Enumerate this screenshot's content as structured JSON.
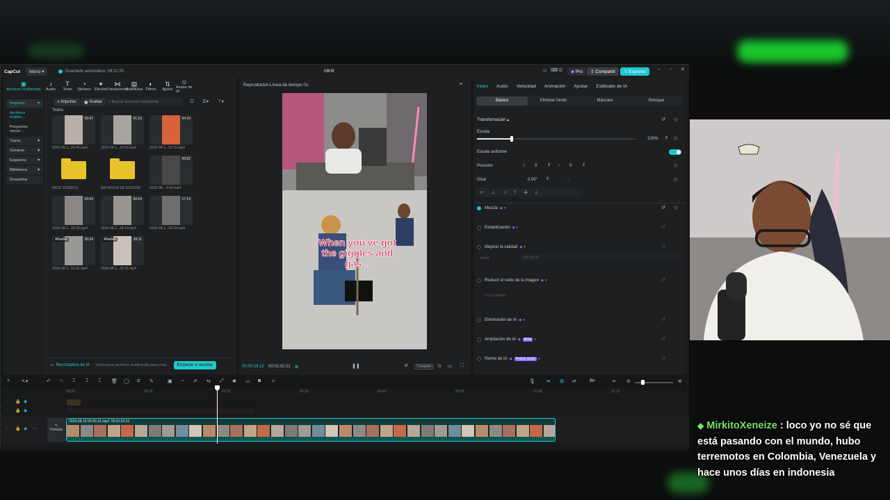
{
  "titlebar": {
    "app_name": "CapCut",
    "menu": "Menú",
    "autosave": "Guardado automático: 09:31:20",
    "project": "0809",
    "pro": "Pro",
    "share": "Compartir",
    "export": "Exportar"
  },
  "toolbar": {
    "items": [
      {
        "icon": "media-icon",
        "label": "Archivos multimedia"
      },
      {
        "icon": "audio-icon",
        "label": "Audio"
      },
      {
        "icon": "text-icon",
        "label": "Texto"
      },
      {
        "icon": "stickers-icon",
        "label": "Stickers"
      },
      {
        "icon": "effects-icon",
        "label": "Efectos"
      },
      {
        "icon": "transitions-icon",
        "label": "Transiciones"
      },
      {
        "icon": "subtitles-icon",
        "label": "Subtítulos"
      },
      {
        "icon": "filters-icon",
        "label": "Filtros"
      },
      {
        "icon": "adjust-icon",
        "label": "Ajuste"
      },
      {
        "icon": "avatar-icon",
        "label": "Avatar de IA"
      }
    ]
  },
  "sidebar": {
    "items": [
      "Importar",
      "Archivos multim...",
      "Proyectos secun...",
      "Tuyos",
      "Generar",
      "Espacios",
      "Biblioteca",
      "Dreamina"
    ]
  },
  "media": {
    "import": "Importar",
    "record": "Grabar",
    "search_placeholder": "Buscar archivos multimedia",
    "all": "Todos",
    "items": [
      {
        "name": "2026-08-1...03-45.mp4",
        "dur": "00:47"
      },
      {
        "name": "2026-08-1...10-09.mp4",
        "dur": "01:16"
      },
      {
        "name": "2026-08-1...22-15.mp4",
        "dur": "04:10"
      },
      {
        "name": "PACK SONIDOS",
        "dur": ""
      },
      {
        "name": "ARCHIVOS DE EDICION",
        "dur": ""
      },
      {
        "name": "2026-08-...4-43.mp4",
        "dur": "00:52"
      },
      {
        "name": "2026-08-1...49-33.mp4",
        "dur": "02:04"
      },
      {
        "name": "2026-08-1...28-13.mp4",
        "dur": "00:04"
      },
      {
        "name": "2026-08-1...26-23.mp4",
        "dur": "17:14"
      },
      {
        "name": "2026-08-1...51-01.mp4",
        "dur": "20:24",
        "badge": "Añadido"
      },
      {
        "name": "2026-08-1...36-31.mp4",
        "dur": "33:11",
        "badge": "Añadido"
      }
    ],
    "cutter_label": "Recortadora de IA",
    "cutter_hint": "Selecciona archivos multimedia para emp...",
    "cutter_button": "Empezar a recortar"
  },
  "player": {
    "title": "Reproductor-Línea de tiempo 01",
    "caption": "When you've got the giggles and gas...",
    "current": "00:00:19:12",
    "total": "00:01:02:21",
    "complete": "Completo"
  },
  "inspector": {
    "tabs": [
      "Vídeo",
      "Audio",
      "Velocidad",
      "Animación",
      "Ajustar",
      "Estilizado de IA"
    ],
    "subtabs": [
      "Básico",
      "Eliminar fondo",
      "Máscara",
      "Retoque"
    ],
    "transform": "Transformación",
    "scale": "Escala",
    "scale_value": "100%",
    "uniform": "Escala uniforme",
    "position": "Posición",
    "pos_x_label": "X",
    "pos_x": "0",
    "pos_y_label": "Y",
    "pos_y": "0",
    "rotate": "Girar",
    "rotate_value": "0.00°",
    "rotate_dash": "-",
    "sections": [
      {
        "label": "Mezcla",
        "on": true
      },
      {
        "label": "Estabilización",
        "on": false
      },
      {
        "label": "Mejorar la calidad",
        "on": false
      },
      {
        "label": "Reducir el ruido de la imagen",
        "on": false
      },
      {
        "label": "Eliminación de IA",
        "on": false
      },
      {
        "label": "Ampliación de IA",
        "on": false,
        "badge": "Beta"
      },
      {
        "label": "Remix de IA",
        "on": false,
        "badge": "Probar gratis"
      }
    ],
    "quality_sub": "Nivel",
    "quality_value": "HD de IA",
    "noise_sub": "Paso óptimo"
  },
  "timeline": {
    "ruler": [
      "00:00",
      "00:10",
      "00:20",
      "00:30",
      "00:40",
      "00:50",
      "01:00",
      "01:10"
    ],
    "cover": "Portada",
    "clip_name": "2026-08-10 03-56-31.mp4",
    "clip_dur": "00:01:02:21"
  },
  "chat": {
    "user": "MirkitoXeneize",
    "message": "loco yo no sé que está pasando con el mundo, hubo terremotos en Colombia, Venezuela y hace unos días en indonesia",
    "name_color": "#7be36b"
  },
  "colors": {
    "accent": "#21c9c9",
    "export": "#1ec8d4",
    "pro": "#8a6cff"
  }
}
